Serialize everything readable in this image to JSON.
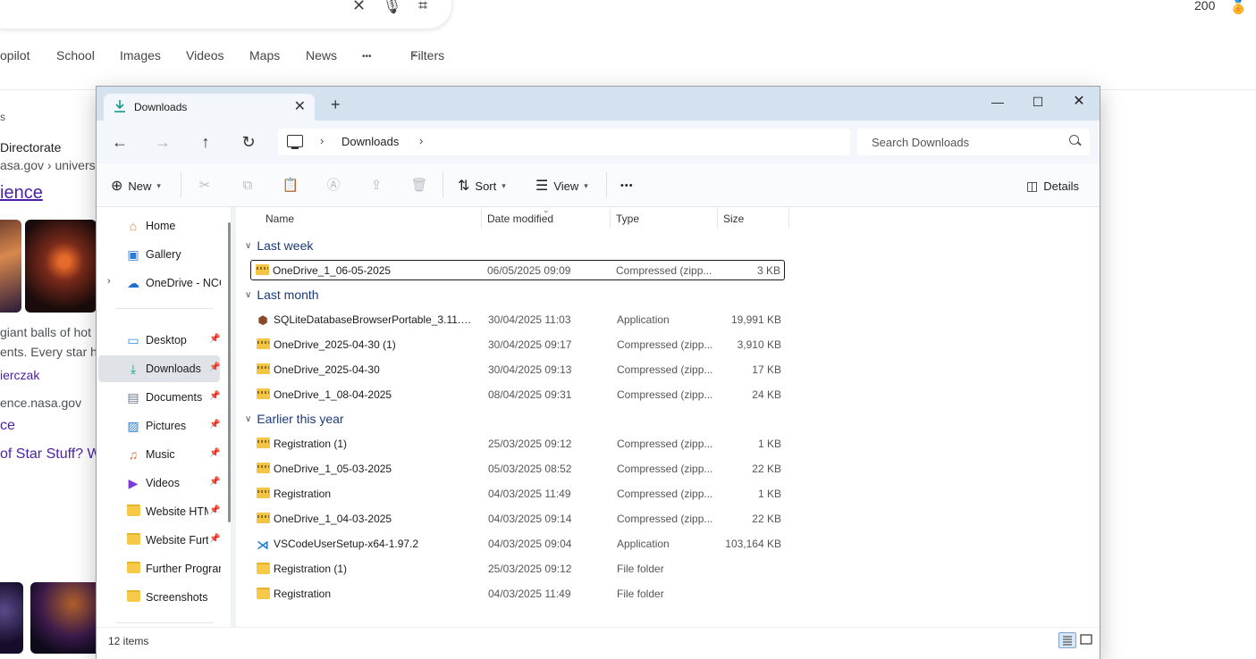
{
  "browser": {
    "search_icons": [
      "close-icon",
      "microphone-icon",
      "visual-search-icon"
    ],
    "rewards_count": "200",
    "tabs": [
      "opilot",
      "School",
      "Images",
      "Videos",
      "Maps",
      "News",
      "•••",
      "Filters"
    ],
    "results": {
      "line1": "s",
      "line2": "Directorate",
      "line3": "asa.gov › universe",
      "link1": "ience",
      "snippet1": "giant balls of hot",
      "snippet2": "ents. Every star ha",
      "link2": "ierczak",
      "domain2": "ence.nasa.gov",
      "link3": "ce",
      "link4": "of Star Stuff? We"
    }
  },
  "window": {
    "tab_title": "Downloads",
    "tab_icon": "download-arrow-icon",
    "new_tab": "+",
    "address": {
      "crumb": "Downloads",
      "separator": "›"
    },
    "search": {
      "placeholder": "Search Downloads"
    },
    "toolbar": {
      "new_label": "New",
      "sort_label": "Sort",
      "view_label": "View",
      "more_label": "•••",
      "details_label": "Details"
    },
    "sidebar": {
      "items": [
        {
          "label": "Home",
          "icon": "home-icon"
        },
        {
          "label": "Gallery",
          "icon": "gallery-icon"
        },
        {
          "label": "OneDrive - NCG",
          "icon": "cloud-icon"
        },
        {
          "label": "Desktop",
          "icon": "desktop-icon"
        },
        {
          "label": "Downloads",
          "icon": "download-arrow-icon"
        },
        {
          "label": "Documents",
          "icon": "documents-icon"
        },
        {
          "label": "Pictures",
          "icon": "pictures-icon"
        },
        {
          "label": "Music",
          "icon": "music-icon"
        },
        {
          "label": "Videos",
          "icon": "videos-icon"
        },
        {
          "label": "Website HTML",
          "icon": "folder-icon"
        },
        {
          "label": "Website Further",
          "icon": "folder-icon"
        },
        {
          "label": "Further Programming",
          "icon": "folder-icon"
        },
        {
          "label": "Screenshots",
          "icon": "folder-icon"
        }
      ]
    },
    "columns": {
      "name": "Name",
      "date": "Date modified",
      "type": "Type",
      "size": "Size"
    },
    "groups": [
      {
        "label": "Last week",
        "rows": [
          {
            "name": "OneDrive_1_06-05-2025",
            "date": "06/05/2025 09:09",
            "type": "Compressed (zipp...",
            "size": "3 KB",
            "icon": "zip-icon"
          }
        ]
      },
      {
        "label": "Last month",
        "rows": [
          {
            "name": "SQLiteDatabaseBrowserPortable_3.11.2_E...",
            "date": "30/04/2025 11:03",
            "type": "Application",
            "size": "19,991 KB",
            "icon": "app-icon"
          },
          {
            "name": "OneDrive_2025-04-30 (1)",
            "date": "30/04/2025 09:17",
            "type": "Compressed (zipp...",
            "size": "3,910 KB",
            "icon": "zip-icon"
          },
          {
            "name": "OneDrive_2025-04-30",
            "date": "30/04/2025 09:13",
            "type": "Compressed (zipp...",
            "size": "17 KB",
            "icon": "zip-icon"
          },
          {
            "name": "OneDrive_1_08-04-2025",
            "date": "08/04/2025 09:31",
            "type": "Compressed (zipp...",
            "size": "24 KB",
            "icon": "zip-icon"
          }
        ]
      },
      {
        "label": "Earlier this year",
        "rows": [
          {
            "name": "Registration (1)",
            "date": "25/03/2025 09:12",
            "type": "Compressed (zipp...",
            "size": "1 KB",
            "icon": "zip-icon"
          },
          {
            "name": "OneDrive_1_05-03-2025",
            "date": "05/03/2025 08:52",
            "type": "Compressed (zipp...",
            "size": "22 KB",
            "icon": "zip-icon"
          },
          {
            "name": "Registration",
            "date": "04/03/2025 11:49",
            "type": "Compressed (zipp...",
            "size": "1 KB",
            "icon": "zip-icon"
          },
          {
            "name": "OneDrive_1_04-03-2025",
            "date": "04/03/2025 09:14",
            "type": "Compressed (zipp...",
            "size": "22 KB",
            "icon": "zip-icon"
          },
          {
            "name": "VSCodeUserSetup-x64-1.97.2",
            "date": "04/03/2025 09:04",
            "type": "Application",
            "size": "103,164 KB",
            "icon": "vscode-icon"
          },
          {
            "name": "Registration (1)",
            "date": "25/03/2025 09:12",
            "type": "File folder",
            "size": "",
            "icon": "folder-icon"
          },
          {
            "name": "Registration",
            "date": "04/03/2025 11:49",
            "type": "File folder",
            "size": "",
            "icon": "folder-icon"
          }
        ]
      }
    ],
    "status": {
      "item_count": "12 items"
    },
    "colors": {
      "titlebar": "#d4e1ef",
      "accent": "#0f9d8a",
      "group_text": "#1b3a79"
    }
  }
}
